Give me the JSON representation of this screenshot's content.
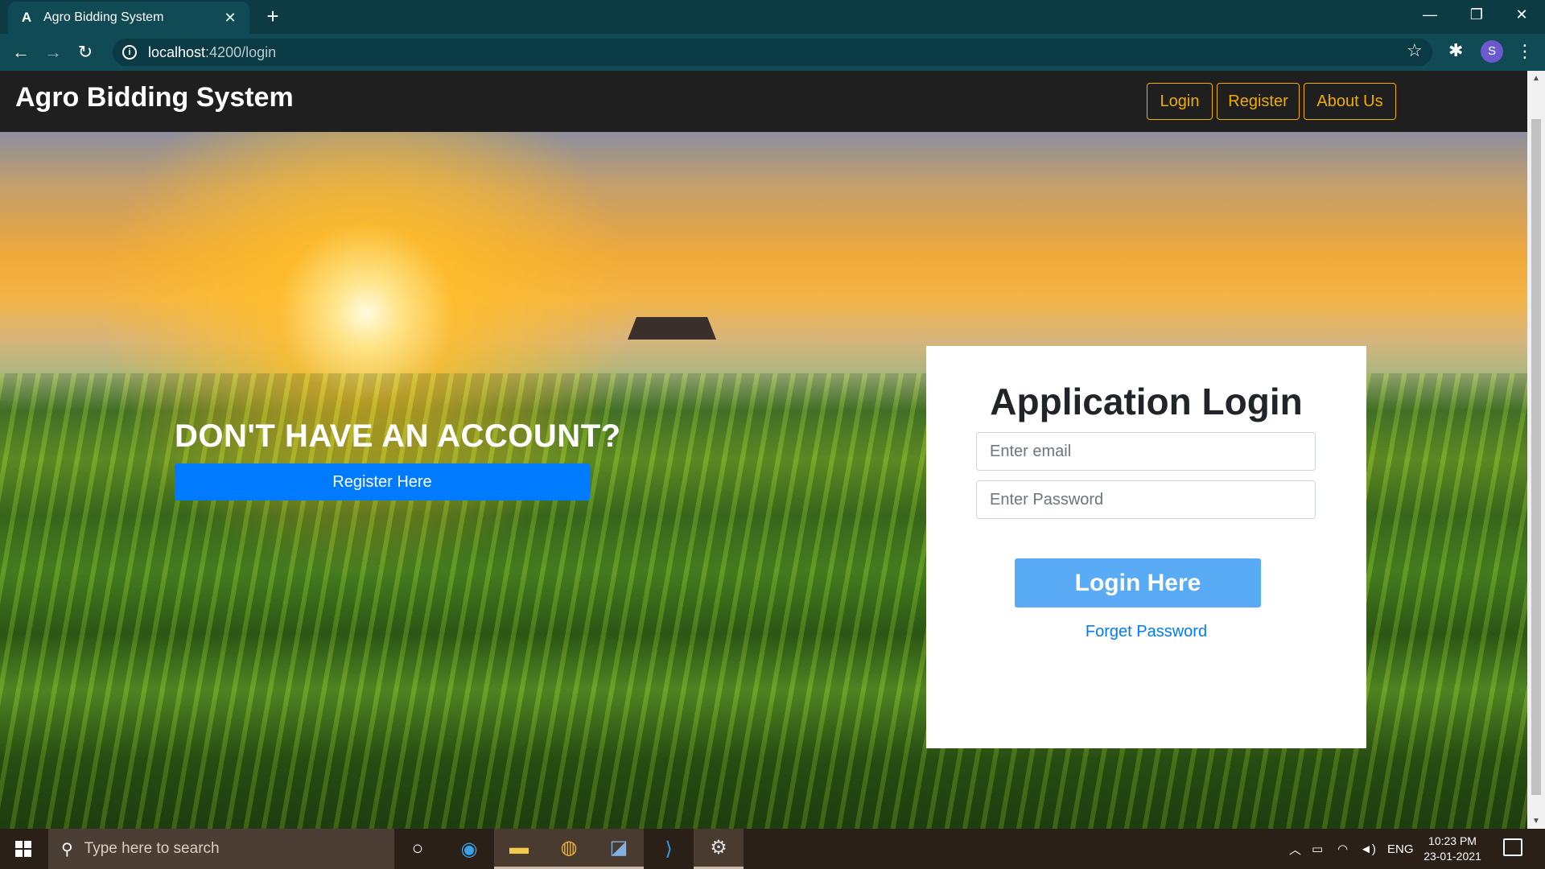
{
  "browser": {
    "tab_title": "Agro Bidding System",
    "tab_favicon": "A",
    "tab_close": "✕",
    "new_tab": "+",
    "url_host": "localhost",
    "url_path": ":4200/login",
    "profile_initial": "S"
  },
  "navbar": {
    "brand": "Agro Bidding System",
    "links": [
      {
        "label": "Login"
      },
      {
        "label": "Register"
      },
      {
        "label": "About Us"
      }
    ]
  },
  "hero": {
    "cta_heading": "DON'T HAVE AN ACCOUNT?",
    "cta_button": "Register Here"
  },
  "login": {
    "title": "Application Login",
    "email_placeholder": "Enter email",
    "password_placeholder": "Enter Password",
    "submit_label": "Login Here",
    "forgot_label": "Forget Password"
  },
  "taskbar": {
    "search_placeholder": "Type here to search",
    "language": "ENG",
    "time": "10:23 PM",
    "date": "23-01-2021"
  },
  "colors": {
    "navbar_bg": "#1f1f1f",
    "nav_accent": "#f0ad00",
    "primary": "#007bff",
    "login_button": "#5aabf5",
    "chrome_teal": "#0f4a55"
  },
  "icons": [
    "back-icon",
    "forward-icon",
    "reload-icon",
    "info-icon",
    "star-icon",
    "extensions-icon",
    "menu-icon",
    "windows-icon",
    "search-icon",
    "cortana-icon",
    "edge-icon",
    "file-explorer-icon",
    "chrome-icon",
    "ide-icon",
    "vscode-icon",
    "settings-icon"
  ]
}
